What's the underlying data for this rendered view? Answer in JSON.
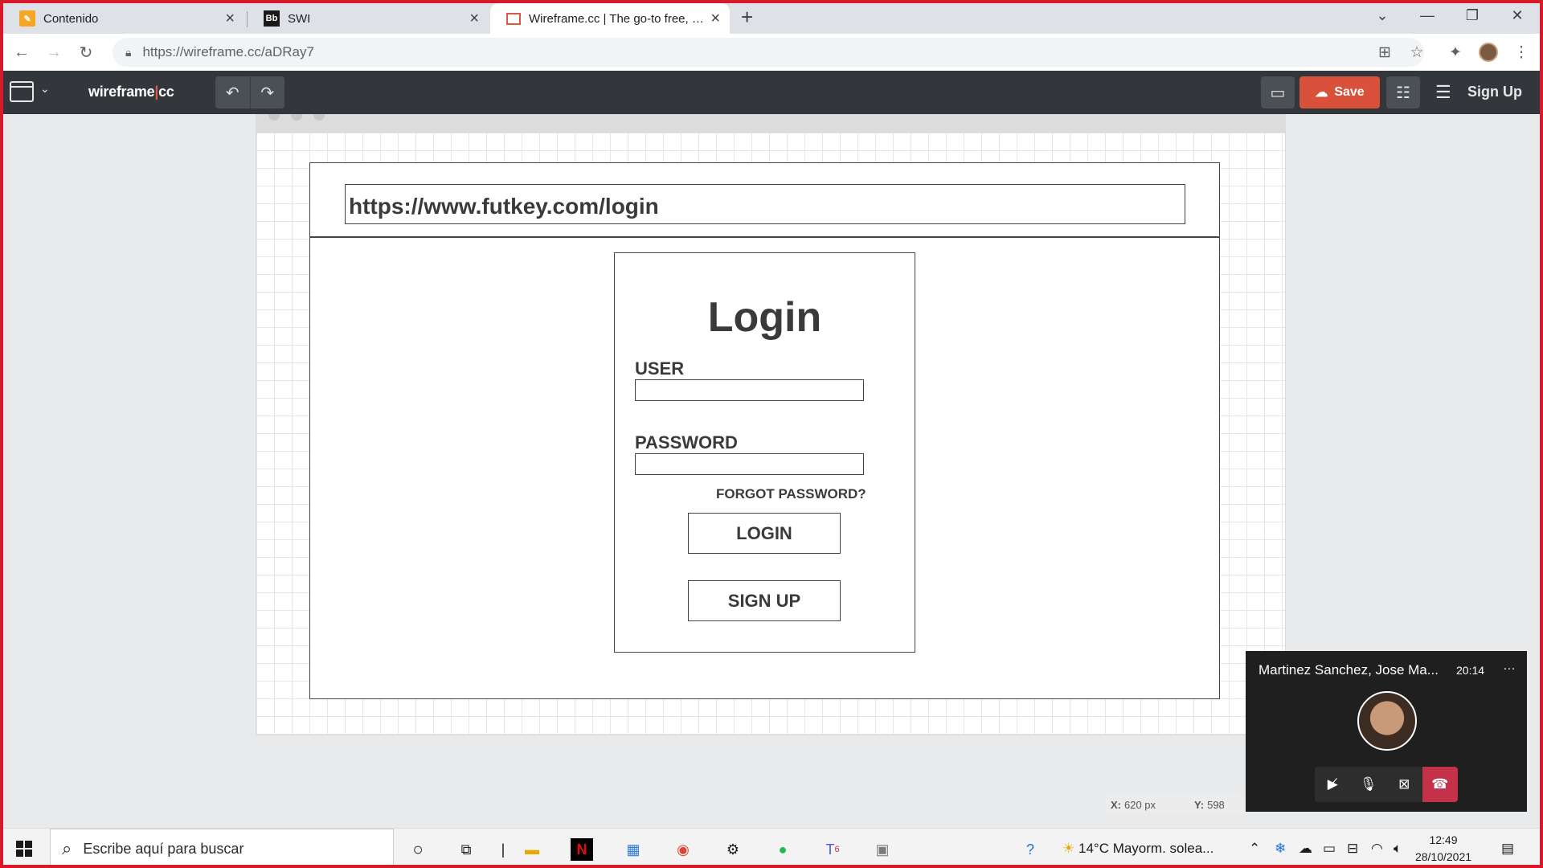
{
  "browser": {
    "tabs": [
      {
        "title": "Contenido",
        "icon": "pencil-doc-icon",
        "active": false
      },
      {
        "title": "SWI",
        "icon": "blackboard-icon",
        "active": false
      },
      {
        "title": "Wireframe.cc | The go-to free, on",
        "icon": "wireframe-icon",
        "active": true
      }
    ],
    "url": "https://wireframe.cc/aDRay7"
  },
  "app": {
    "logo_main": "wireframe",
    "logo_sep": "|",
    "logo_tail": "cc",
    "save_label": "Save",
    "signup_label": "Sign Up"
  },
  "wireframe": {
    "url_text": "https://www.futkey.com/login",
    "title": "Login",
    "user_label": "USER",
    "password_label": "PASSWORD",
    "forgot_label": "FORGOT PASSWORD?",
    "login_button": "LOGIN",
    "signup_button": "SIGN UP"
  },
  "coords": {
    "x_label": "X:",
    "x_value": "620 px",
    "y_label": "Y:",
    "y_value": "598"
  },
  "call": {
    "name": "Martinez Sanchez, Jose Ma...",
    "timer": "20:14"
  },
  "taskbar": {
    "search_placeholder": "Escribe aquí para buscar",
    "weather": "14°C  Mayorm. solea...",
    "time": "12:49",
    "date": "28/10/2021",
    "teams_badge": "6"
  },
  "colors": {
    "accent": "#d9503b",
    "appbar": "#33373b",
    "frame": "#d7192b"
  }
}
